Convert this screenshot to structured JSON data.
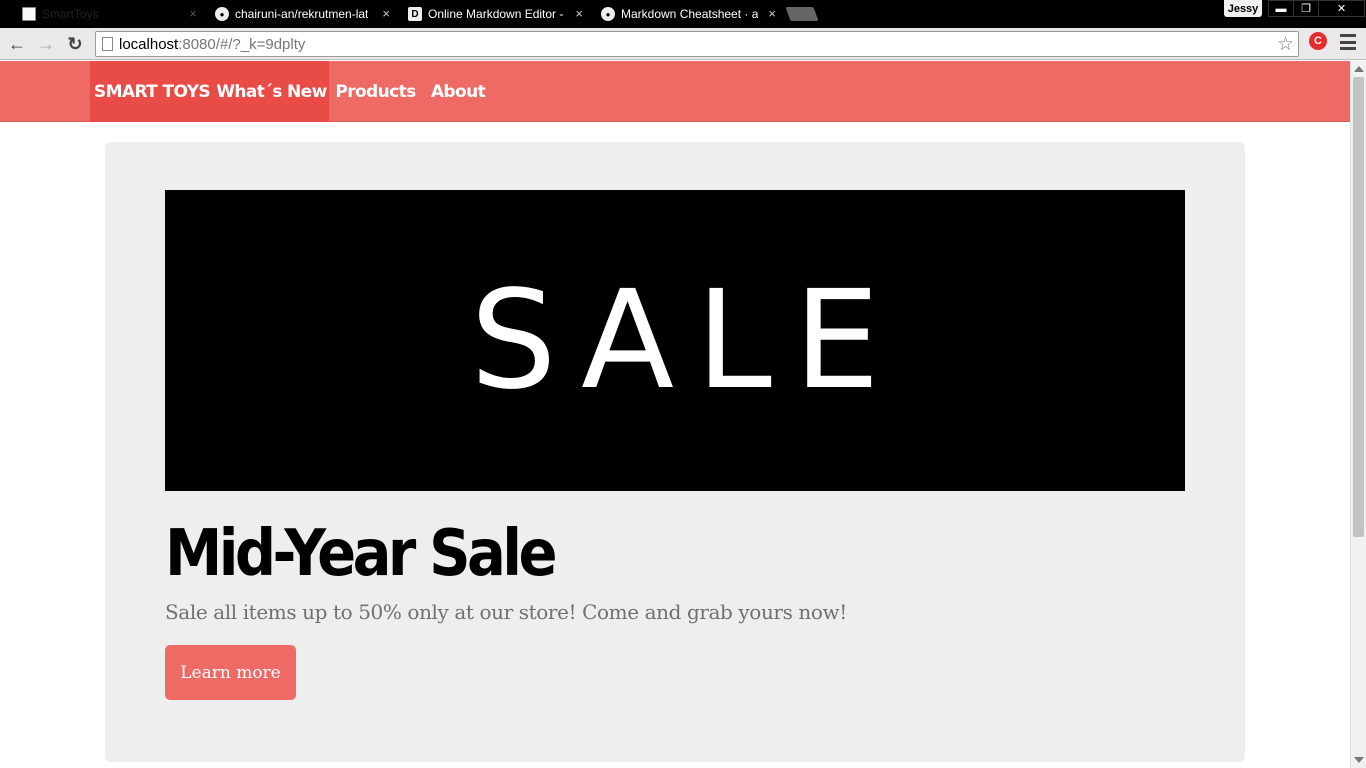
{
  "browser": {
    "tabs": [
      {
        "title": "SmartToys",
        "icon": "page-icon",
        "active": true
      },
      {
        "title": "chairuni-an/rekrutmen-lat",
        "icon": "github-icon",
        "active": false
      },
      {
        "title": "Online Markdown Editor -",
        "icon": "dillinger-icon",
        "active": false
      },
      {
        "title": "Markdown Cheatsheet · a",
        "icon": "github-icon",
        "active": false
      }
    ],
    "tab_close": "×",
    "profile_name": "Jessy",
    "url_host": "localhost",
    "url_path": ":8080/#/?_k=9dplty"
  },
  "site": {
    "brand": "SMART TOYS",
    "nav": [
      "What´s New",
      "Products",
      "About"
    ],
    "active_nav": "What´s New",
    "accent_color": "#ee6a65"
  },
  "hero": {
    "banner_text": "SALE",
    "headline": "Mid-Year Sale",
    "lead": "Sale all items up to 50% only at our store! Come and grab yours now!",
    "cta": "Learn more"
  }
}
